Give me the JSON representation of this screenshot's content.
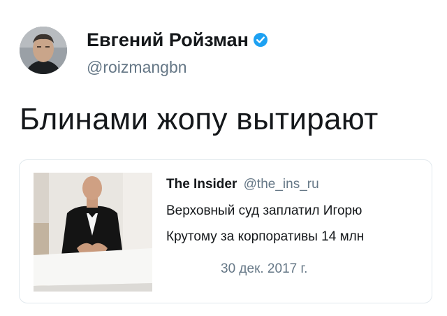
{
  "author": {
    "name": "Евгений Ройзман",
    "handle": "@roizmangbn",
    "verified": true
  },
  "tweet": {
    "text": "Блинами жопу вытирают"
  },
  "quoted_tweet": {
    "name": "The Insider",
    "handle": "@the_ins_ru",
    "text_line1": "Верховный суд заплатил Игорю",
    "text_line2": "Крутому за корпоративы 14 млн",
    "date": "30 дек. 2017 г."
  },
  "colors": {
    "verified_badge": "#1da1f2",
    "secondary_text": "#657786",
    "card_border": "#e1e8ed"
  }
}
